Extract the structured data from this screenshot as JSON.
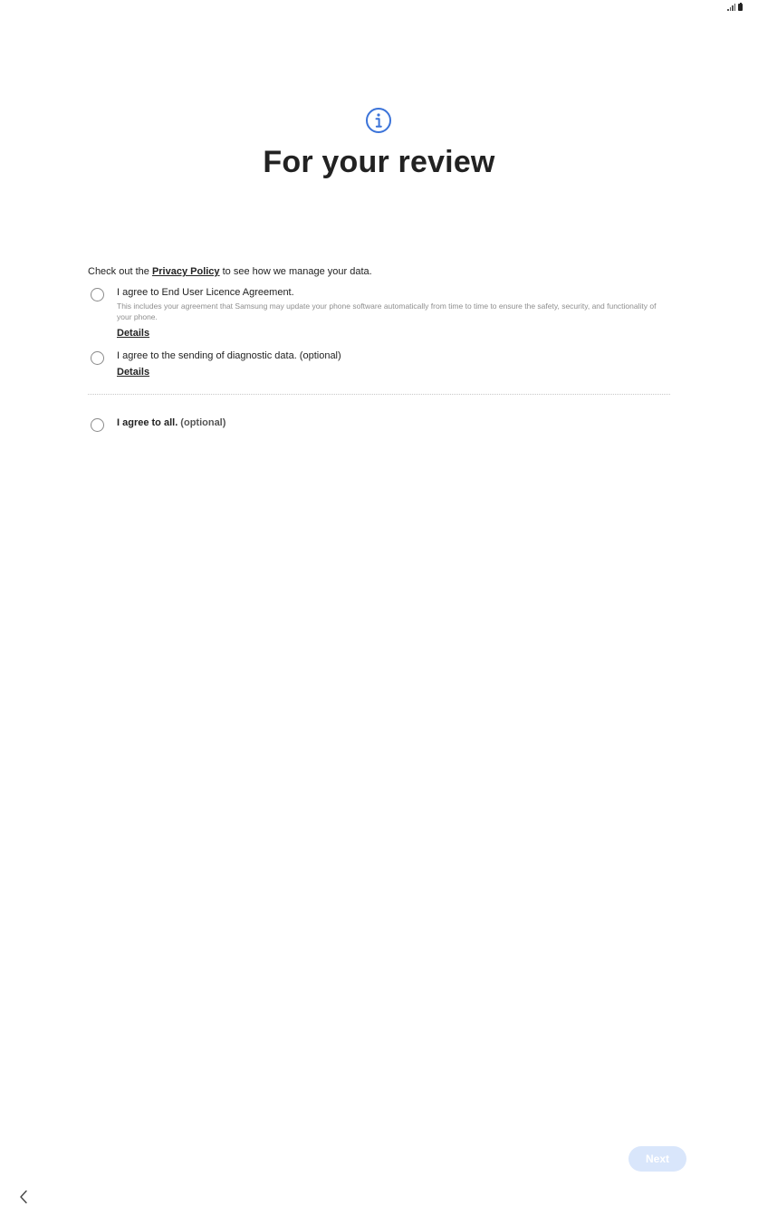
{
  "status_bar": {
    "signal_icon": "signal-icon",
    "battery_icon": "battery-icon"
  },
  "header": {
    "icon": "info-icon",
    "accent_color": "#3b73d9",
    "title": "For your review"
  },
  "privacy": {
    "prefix": "Check out the ",
    "link_label": "Privacy Policy",
    "suffix": " to see how we manage your data."
  },
  "agreements": [
    {
      "label": "I agree to End User Licence Agreement.",
      "description": "This includes your agreement that Samsung may update your phone software automatically from time to time to ensure the safety, security, and functionality of your phone.",
      "details_label": "Details",
      "checked": false
    },
    {
      "label": "I agree to the sending of diagnostic data. (optional)",
      "details_label": "Details",
      "checked": false
    }
  ],
  "agree_all": {
    "label": "I agree to all.",
    "optional": " (optional)",
    "checked": false
  },
  "footer": {
    "next_label": "Next",
    "next_color": "#d9e6fb",
    "back_icon": "chevron-left-icon"
  }
}
